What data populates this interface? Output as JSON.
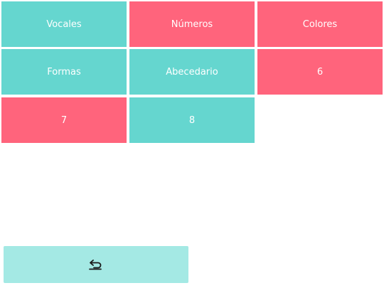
{
  "tiles": [
    {
      "label": "Vocales",
      "color": "teal"
    },
    {
      "label": "Números",
      "color": "pink"
    },
    {
      "label": "Colores",
      "color": "pink"
    },
    {
      "label": "Formas",
      "color": "teal"
    },
    {
      "label": "Abecedario",
      "color": "teal"
    },
    {
      "label": "6",
      "color": "pink"
    },
    {
      "label": "7",
      "color": "pink"
    },
    {
      "label": "8",
      "color": "teal"
    }
  ],
  "colors": {
    "teal": "#65d6cf",
    "pink": "#ff647c",
    "back_button": "#a4e9e4"
  },
  "back_button": {
    "icon": "return-arrow-icon"
  }
}
